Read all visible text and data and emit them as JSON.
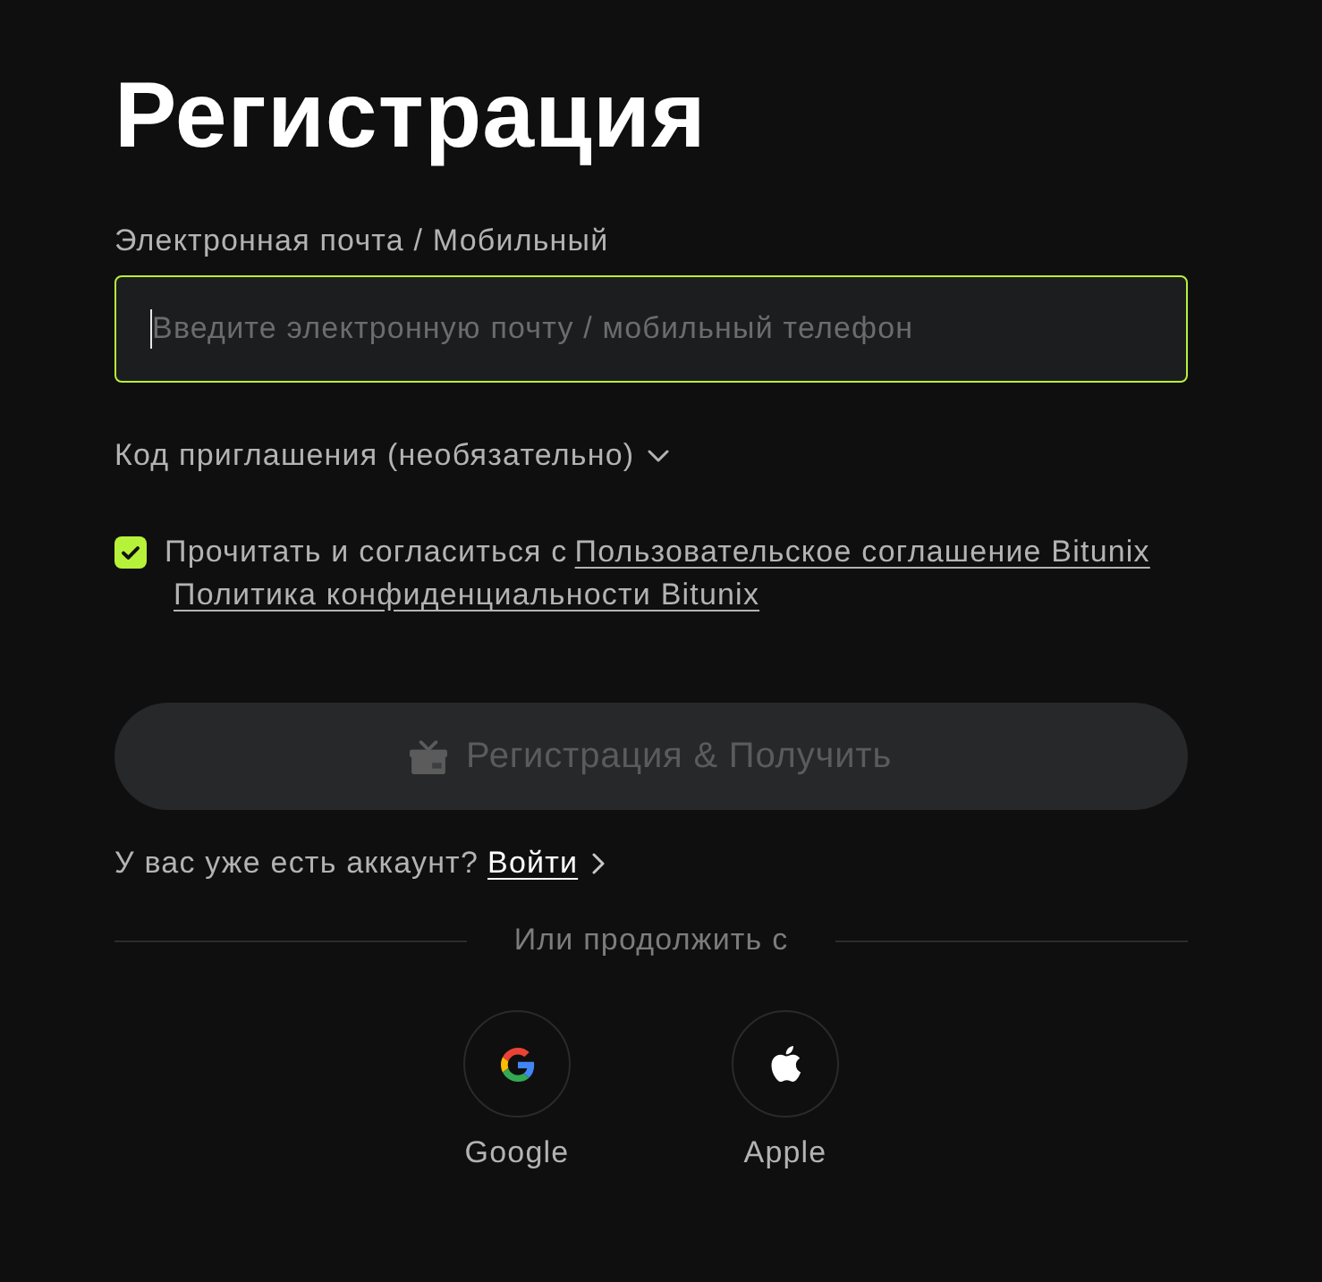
{
  "title": "Регистрация",
  "email_field": {
    "label": "Электронная почта / Мобильный",
    "placeholder": "Введите электронную почту / мобильный телефон",
    "focused": true
  },
  "invite_code": {
    "label": "Код приглашения (необязательно)",
    "expanded": false
  },
  "agreement": {
    "checked": true,
    "text": "Прочитать и согласиться с",
    "links": [
      "Пользовательское соглашение Bitunix",
      "Политика конфиденциальности Bitunix"
    ]
  },
  "submit_button": {
    "label": "Регистрация & Получить",
    "disabled": true
  },
  "login_prompt": {
    "text": "У вас уже есть аккаунт?",
    "link": "Войти"
  },
  "divider_text": "Или продолжить с",
  "social_logins": [
    {
      "kind": "google",
      "label": "Google"
    },
    {
      "kind": "apple",
      "label": "Apple"
    }
  ]
}
